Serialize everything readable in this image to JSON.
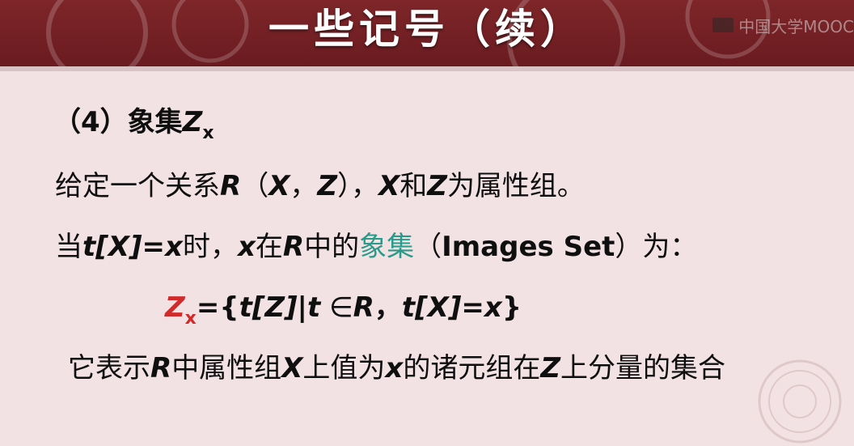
{
  "header": {
    "title": "一些记号（续）",
    "watermark": "中国大学MOOC"
  },
  "content": {
    "l1": {
      "num": "（4）",
      "text": "象集",
      "sym": "Z",
      "sub": "x"
    },
    "l2": {
      "p1": "给定一个关系",
      "R": "R",
      "p2": "（",
      "X": "X",
      "comma": "，",
      "Z": "Z",
      "p3": "），",
      "X2": "X",
      "he": "和",
      "Z2": "Z",
      "p4": "为属性组。"
    },
    "l3": {
      "p1": "当",
      "expr": "t[X]=x",
      "p2": "时，",
      "x": "x",
      "p3": "在",
      "R": "R",
      "p4": "中的",
      "highlight": "象集",
      "p5": "（",
      "en": "Images Set",
      "p6": "）为："
    },
    "l4": {
      "Z": "Z",
      "sub": "x",
      "p1": "={",
      "tZ": "t[Z]",
      "bar": "|",
      "t": "t",
      "in": " ∈",
      "R": "R",
      "comma": "，",
      "tX": "t[X]=x",
      "close": "}"
    },
    "l5": {
      "p1": "它表示",
      "R": "R",
      "p2": "中属性组",
      "X": "X",
      "p3": "上值为",
      "x": "x",
      "p4": "的诸元组在",
      "Z": "Z",
      "p5": "上分量的集合"
    }
  },
  "colors": {
    "header": "#7e2629",
    "background": "#f3e2e4",
    "red": "#d02a2a",
    "teal": "#2a9a8a"
  }
}
